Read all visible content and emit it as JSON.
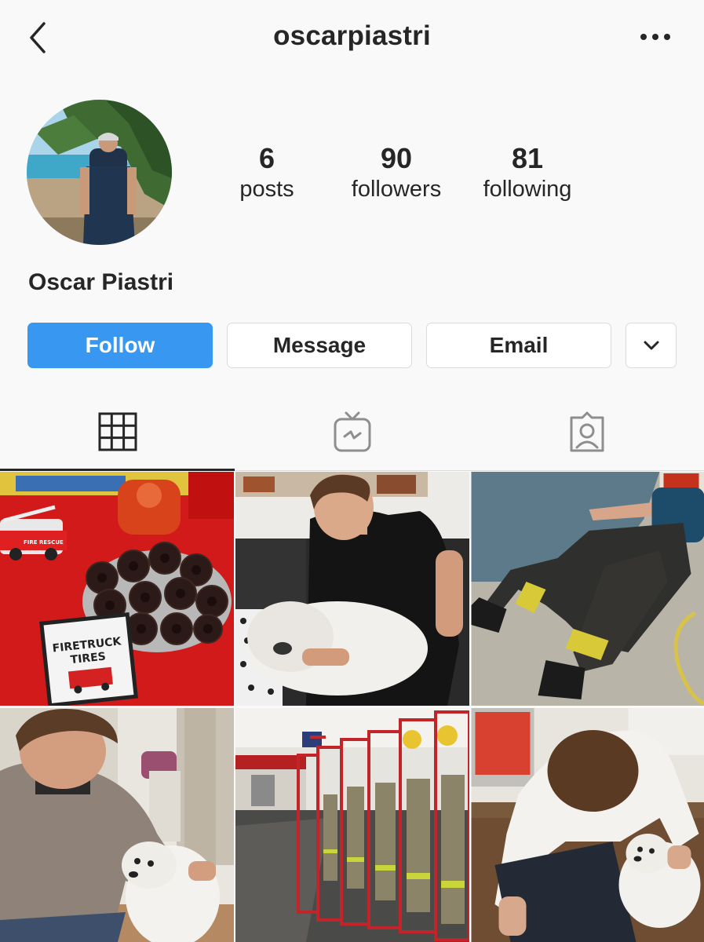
{
  "header": {
    "username": "oscarpiastri",
    "back_icon": "chevron-left-icon",
    "more_icon": "more-horizontal-icon"
  },
  "profile": {
    "name": "Oscar Piastri",
    "stats": [
      {
        "value": "6",
        "label": "posts"
      },
      {
        "value": "90",
        "label": "followers"
      },
      {
        "value": "81",
        "label": "following"
      }
    ]
  },
  "buttons": {
    "follow": "Follow",
    "message": "Message",
    "email": "Email",
    "more_icon": "chevron-down-icon"
  },
  "tabs": [
    {
      "icon": "grid-icon",
      "active": true
    },
    {
      "icon": "igtv-icon",
      "active": false
    },
    {
      "icon": "tagged-icon",
      "active": false
    }
  ],
  "posts": [
    {
      "sign_line1": "FIRETRUCK",
      "sign_line2": "TIRES",
      "truck_label": "FIRE RESCUE"
    },
    {},
    {},
    {},
    {},
    {}
  ],
  "colors": {
    "accent": "#3897f0",
    "text": "#262626",
    "border": "#dbdbdb",
    "background": "#f9f9f9"
  }
}
